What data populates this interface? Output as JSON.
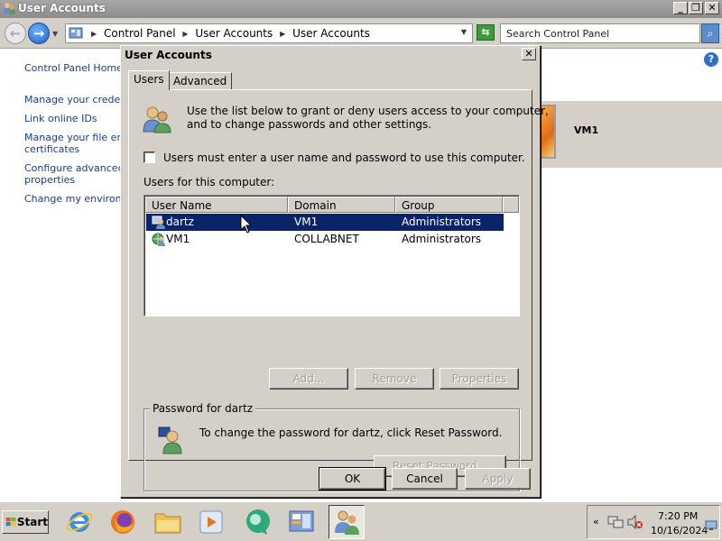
{
  "window": {
    "title": "User Accounts",
    "caption_minimize": "_",
    "caption_restore": "❐",
    "caption_close": "✕"
  },
  "address_bar": {
    "breadcrumbs": [
      "Control Panel",
      "User Accounts",
      "User Accounts"
    ],
    "search_placeholder": "Search Control Panel",
    "back_icon": "back-arrow-icon",
    "forward_icon": "forward-arrow-icon"
  },
  "sidebar": {
    "home": "Control Panel Home",
    "links": [
      "Manage your credenti",
      "Link online IDs",
      "Manage your file encr",
      "certificates",
      "Configure advanced u",
      "properties",
      "Change my environme"
    ]
  },
  "user_tile": {
    "name": "VM1"
  },
  "dialog": {
    "title": "User Accounts",
    "close_label": "✕",
    "tabs": [
      "Users",
      "Advanced"
    ],
    "active_tab": "Users",
    "intro_text_line1": "Use the list below to grant or deny users access to your computer,",
    "intro_text_line2": "and to change passwords and other settings.",
    "checkbox_label": "Users must enter a user name and password to use this computer.",
    "checkbox_checked": false,
    "list_label": "Users for this computer:",
    "columns": [
      "User Name",
      "Domain",
      "Group"
    ],
    "rows": [
      {
        "user": "dartz",
        "domain": "VM1",
        "group": "Administrators",
        "selected": true
      },
      {
        "user": "VM1",
        "domain": "COLLABNET",
        "group": "Administrators",
        "selected": false
      }
    ],
    "buttons": {
      "add": "Add...",
      "remove": "Remove",
      "properties": "Properties"
    },
    "password_group": {
      "legend": "Password for dartz",
      "text": "To change the password for dartz, click Reset Password.",
      "reset_button": "Reset Password..."
    },
    "footer_buttons": {
      "ok": "OK",
      "cancel": "Cancel",
      "apply": "Apply"
    }
  },
  "taskbar": {
    "start_label": "Start",
    "apps": [
      "internet-explorer-icon",
      "firefox-icon",
      "file-explorer-icon",
      "media-player-icon",
      "chat-bubble-icon",
      "control-panel-icon",
      "user-accounts-icon"
    ],
    "clock_time": "7:20 PM",
    "clock_date": "10/16/2024",
    "tray_expand": "«"
  },
  "colors": {
    "selection": "#0a246a",
    "face": "#d4d0c8",
    "link": "#1a3d8f",
    "titlebar_inactive": "#9b9b9b"
  }
}
